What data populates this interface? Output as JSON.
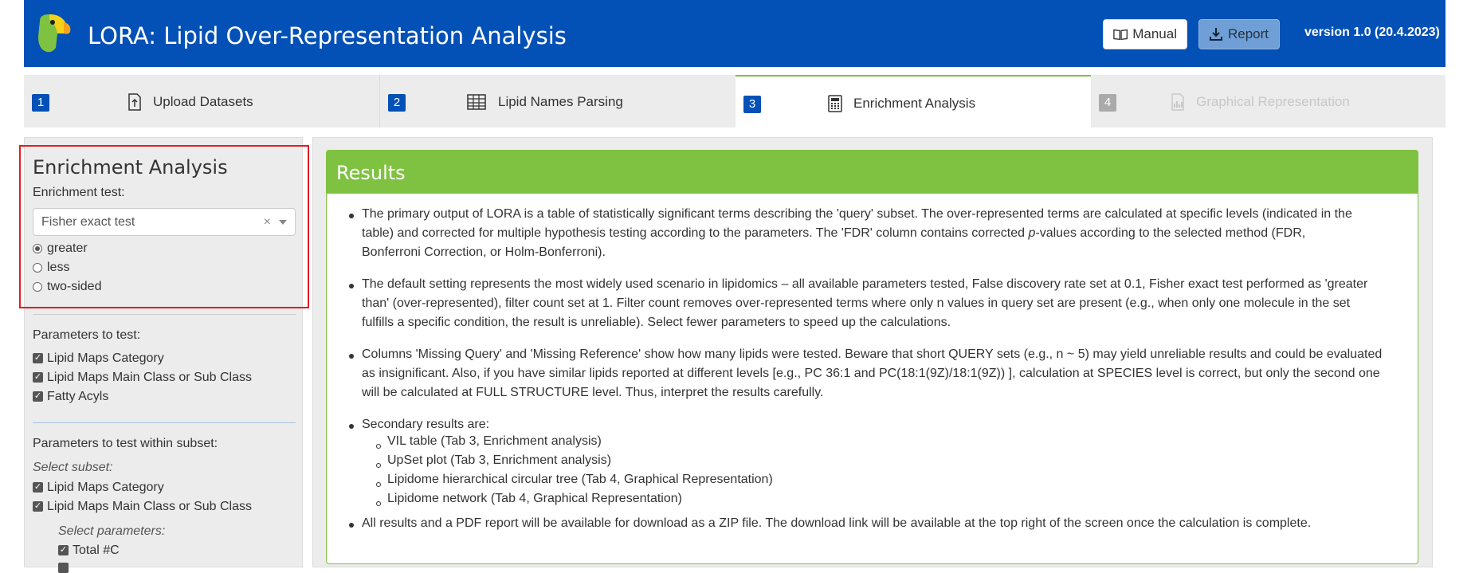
{
  "header": {
    "title": "LORA: Lipid Over-Representation Analysis",
    "manual_label": "Manual",
    "report_label": "Report",
    "version": "version 1.0 (20.4.2023)",
    "bg_color": "#0351b6"
  },
  "tabs": [
    {
      "num": "1",
      "label": "Upload Datasets",
      "icon": "upload-icon"
    },
    {
      "num": "2",
      "label": "Lipid Names Parsing",
      "icon": "table-icon"
    },
    {
      "num": "3",
      "label": "Enrichment Analysis",
      "icon": "calculator-icon"
    },
    {
      "num": "4",
      "label": "Graphical Representation",
      "icon": "chart-icon"
    }
  ],
  "sidebar": {
    "title": "Enrichment Analysis",
    "test_label": "Enrichment test:",
    "test_value": "Fisher exact test",
    "clear_symbol": "×",
    "radios": [
      "greater",
      "less",
      "two-sided"
    ],
    "params_label": "Parameters to test:",
    "params": [
      "Lipid Maps Category",
      "Lipid Maps Main Class or Sub Class",
      "Fatty Acyls"
    ],
    "subset_label": "Parameters to test within subset:",
    "select_subset_label": "Select subset:",
    "subset_items": [
      "Lipid Maps Category",
      "Lipid Maps Main Class or Sub Class"
    ],
    "select_params_label": "Select parameters:",
    "select_params_items": [
      "Total #C"
    ]
  },
  "results": {
    "title": "Results",
    "accent_color": "#7fc241",
    "p1_a": "The primary output of LORA is a table of statistically significant terms describing the 'query' subset. The over-represented terms are calculated at specific levels (indicated in the",
    "p1_b": "table) and corrected for multiple hypothesis testing according to the parameters. The 'FDR' column contains corrected ",
    "p1_b_italic": "p",
    "p1_b_end": "-values according to the selected method (FDR,",
    "p1_c": "Bonferroni Correction, or Holm-Bonferroni).",
    "p2_a": "The default setting represents the most widely used scenario in lipidomics – all available parameters tested, False discovery rate set at 0.1, Fisher exact test performed as 'greater",
    "p2_b": "than' (over-represented), filter count set at 1. Filter count removes over-represented terms where only n values in query set are present (e.g., when only one molecule in the set",
    "p2_c": "fulfills a specific condition, the result is unreliable). Select fewer parameters to speed up the calculations.",
    "p3_a": "Columns 'Missing Query' and 'Missing Reference' show how many lipids were tested. Beware that short QUERY sets (e.g., n ~ 5) may yield unreliable results and could be evaluated",
    "p3_b": "as insignificant. Also, if you have similar lipids reported at different levels [e.g., PC 36:1 and PC(18:1(9Z)/18:1(9Z)) ], calculation at SPECIES level is correct, but only the second one",
    "p3_c": "will be calculated at FULL STRUCTURE level. Thus, interpret the results carefully.",
    "p4": "Secondary results are:",
    "secondary": [
      "VIL table (Tab 3, Enrichment analysis)",
      "UpSet plot (Tab 3, Enrichment analysis)",
      "Lipidome hierarchical circular tree (Tab 4, Graphical Representation)",
      "Lipidome network (Tab 4, Graphical Representation)"
    ],
    "p5": "All results and a PDF report will be available for download as a ZIP file. The download link will be available at the top right of the screen once the calculation is complete."
  }
}
